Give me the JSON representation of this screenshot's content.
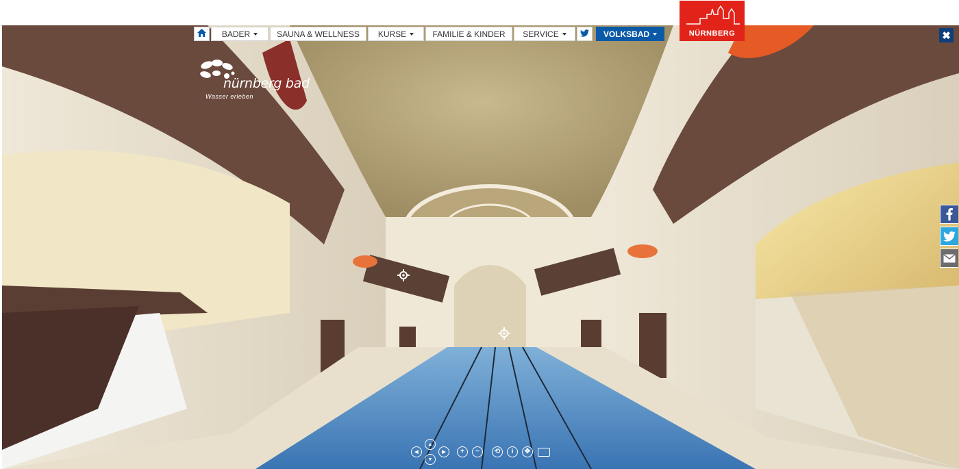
{
  "nav": {
    "home_icon": "home-icon",
    "items": [
      {
        "label": "BADER",
        "dropdown": true
      },
      {
        "label": "SAUNA & WELLNESS",
        "dropdown": false
      },
      {
        "label": "KURSE",
        "dropdown": true
      },
      {
        "label": "FAMILIE & KINDER",
        "dropdown": false
      },
      {
        "label": "SERVICE",
        "dropdown": true
      }
    ],
    "twitter_icon": "twitter-icon",
    "active_item": {
      "label": "VOLKSBAD",
      "dropdown": true
    },
    "active_color": "#0b5aa8"
  },
  "city_logo": {
    "text": "NÜRNBERG",
    "color": "#e2231a"
  },
  "brand": {
    "name": "nürnberg bad",
    "tagline": "Wasser erleben"
  },
  "close": {
    "glyph": "✖"
  },
  "social": [
    {
      "name": "facebook-icon",
      "glyph": "f",
      "color": "#3b5998"
    },
    {
      "name": "twitter-icon",
      "glyph": "t",
      "color": "#2ea7df"
    },
    {
      "name": "mail-icon",
      "glyph": "✉",
      "color": "#6d6d6d"
    }
  ],
  "controls": {
    "up": "▲",
    "down": "▼",
    "left": "◀",
    "right": "▶",
    "zoom_in": "+",
    "zoom_out": "−",
    "autorotate": "⟲",
    "info": "i",
    "move": "✥",
    "fullscreen": "▭"
  }
}
